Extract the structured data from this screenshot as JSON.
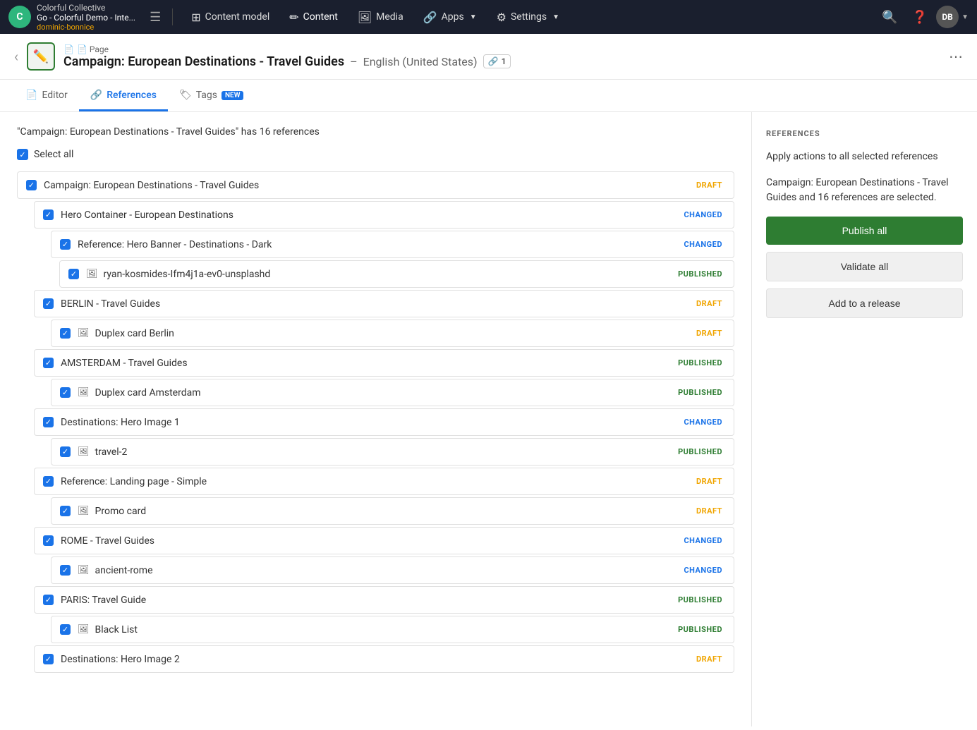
{
  "app": {
    "org": "Colorful Collective",
    "space": "Go - Colorful Demo - Inte...",
    "space_sub": "dominic-bonnice"
  },
  "nav": {
    "items": [
      {
        "id": "content-model",
        "label": "Content model",
        "icon": "⊞"
      },
      {
        "id": "content",
        "label": "Content",
        "icon": "✏️"
      },
      {
        "id": "media",
        "label": "Media",
        "icon": "🖼"
      },
      {
        "id": "apps",
        "label": "Apps",
        "icon": "🔗",
        "has_dropdown": true
      },
      {
        "id": "settings",
        "label": "Settings",
        "icon": "⚙",
        "has_dropdown": true
      }
    ]
  },
  "header": {
    "breadcrumb": "📄 Page",
    "title": "Campaign: European Destinations - Travel Guides",
    "locale": "English (United States)",
    "links_count": "1"
  },
  "tabs": [
    {
      "id": "editor",
      "label": "Editor",
      "active": false
    },
    {
      "id": "references",
      "label": "References",
      "active": true
    },
    {
      "id": "tags",
      "label": "Tags",
      "badge": "NEW",
      "active": false
    }
  ],
  "references": {
    "description": "\"Campaign: European Destinations - Travel Guides\" has 16 references",
    "select_all_label": "Select all",
    "items": [
      {
        "id": "r1",
        "indent": 0,
        "title": "Campaign: European Destinations - Travel Guides",
        "status": "DRAFT",
        "status_type": "draft",
        "has_image": false
      },
      {
        "id": "r2",
        "indent": 1,
        "title": "Hero Container - European Destinations",
        "status": "CHANGED",
        "status_type": "changed",
        "has_image": false
      },
      {
        "id": "r3",
        "indent": 2,
        "title": "Reference: Hero Banner - Destinations - Dark",
        "status": "CHANGED",
        "status_type": "changed",
        "has_image": false
      },
      {
        "id": "r4",
        "indent": 3,
        "title": "ryan-kosmides-Ifm4j1a-ev0-unsplashd",
        "status": "PUBLISHED",
        "status_type": "published",
        "has_image": true
      },
      {
        "id": "r5",
        "indent": 1,
        "title": "BERLIN - Travel Guides",
        "status": "DRAFT",
        "status_type": "draft",
        "has_image": false
      },
      {
        "id": "r6",
        "indent": 2,
        "title": "Duplex card Berlin",
        "status": "DRAFT",
        "status_type": "draft",
        "has_image": true
      },
      {
        "id": "r7",
        "indent": 1,
        "title": "AMSTERDAM - Travel Guides",
        "status": "PUBLISHED",
        "status_type": "published",
        "has_image": false
      },
      {
        "id": "r8",
        "indent": 2,
        "title": "Duplex card Amsterdam",
        "status": "PUBLISHED",
        "status_type": "published",
        "has_image": true
      },
      {
        "id": "r9",
        "indent": 1,
        "title": "Destinations: Hero Image 1",
        "status": "CHANGED",
        "status_type": "changed",
        "has_image": false
      },
      {
        "id": "r10",
        "indent": 2,
        "title": "travel-2",
        "status": "PUBLISHED",
        "status_type": "published",
        "has_image": true
      },
      {
        "id": "r11",
        "indent": 1,
        "title": "Reference: Landing page - Simple",
        "status": "DRAFT",
        "status_type": "draft",
        "has_image": false
      },
      {
        "id": "r12",
        "indent": 2,
        "title": "Promo card",
        "status": "DRAFT",
        "status_type": "draft",
        "has_image": true
      },
      {
        "id": "r13",
        "indent": 1,
        "title": "ROME - Travel Guides",
        "status": "CHANGED",
        "status_type": "changed",
        "has_image": false
      },
      {
        "id": "r14",
        "indent": 2,
        "title": "ancient-rome",
        "status": "CHANGED",
        "status_type": "changed",
        "has_image": true
      },
      {
        "id": "r15",
        "indent": 1,
        "title": "PARIS: Travel Guide",
        "status": "PUBLISHED",
        "status_type": "published",
        "has_image": false
      },
      {
        "id": "r16",
        "indent": 2,
        "title": "Black List",
        "status": "PUBLISHED",
        "status_type": "published",
        "has_image": true
      },
      {
        "id": "r17",
        "indent": 1,
        "title": "Destinations: Hero Image 2",
        "status": "DRAFT",
        "status_type": "draft",
        "has_image": false
      }
    ]
  },
  "right_panel": {
    "title": "REFERENCES",
    "description": "Apply actions to all selected references",
    "selected_info": "Campaign: European Destinations - Travel Guides and 16 references are selected.",
    "publish_all": "Publish all",
    "validate_all": "Validate all",
    "add_to_release": "Add to a release"
  }
}
